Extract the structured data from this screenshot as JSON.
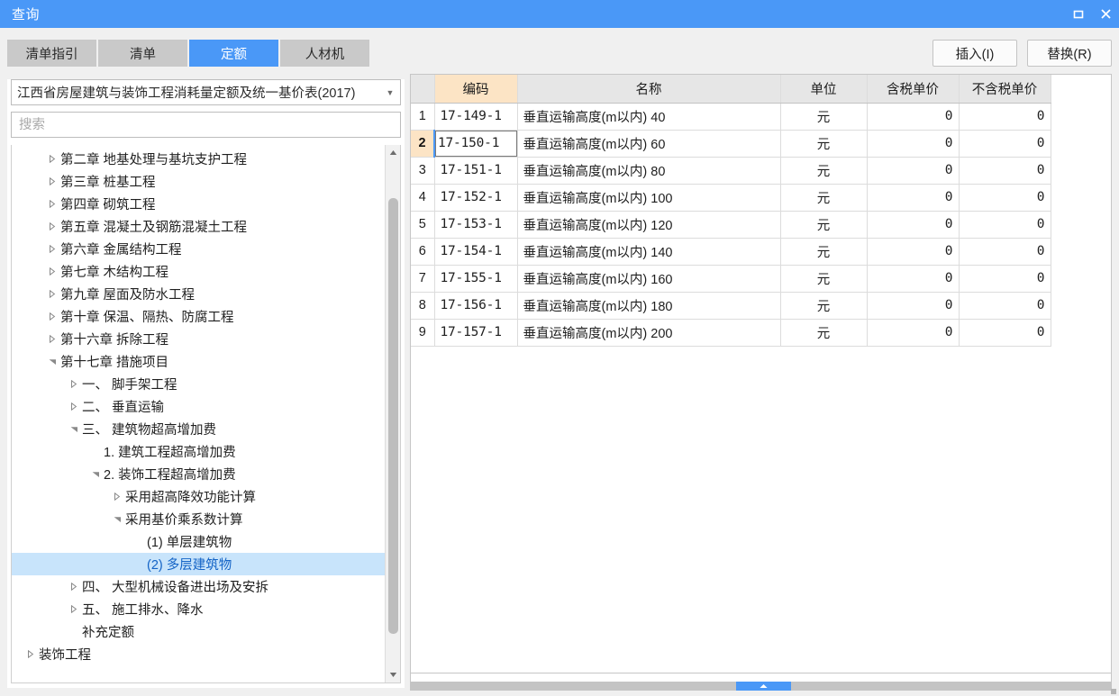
{
  "window": {
    "title": "查询",
    "controls": [
      {
        "name": "maximize",
        "icon": "maximize-icon"
      },
      {
        "name": "close",
        "icon": "close-icon"
      }
    ],
    "titlebar_color": "#4a98f7"
  },
  "tabs": [
    {
      "label": "清单指引",
      "active": false
    },
    {
      "label": "清单",
      "active": false
    },
    {
      "label": "定额",
      "active": true
    },
    {
      "label": "人材机",
      "active": false
    }
  ],
  "toolbar": {
    "insert_label": "插入(I)",
    "replace_label": "替换(R)"
  },
  "sidebar": {
    "library_select": {
      "value": "江西省房屋建筑与装饰工程消耗量定额及统一基价表(2017)",
      "arrow_icon": "chevron-down-icon"
    },
    "search": {
      "value": "",
      "placeholder": "搜索"
    },
    "tree": [
      {
        "label": "第二章 地基处理与基坑支护工程",
        "indent": 1,
        "state": "collapsed",
        "selected": false
      },
      {
        "label": "第三章 桩基工程",
        "indent": 1,
        "state": "collapsed",
        "selected": false
      },
      {
        "label": "第四章 砌筑工程",
        "indent": 1,
        "state": "collapsed",
        "selected": false
      },
      {
        "label": "第五章 混凝土及钢筋混凝土工程",
        "indent": 1,
        "state": "collapsed",
        "selected": false
      },
      {
        "label": "第六章 金属结构工程",
        "indent": 1,
        "state": "collapsed",
        "selected": false
      },
      {
        "label": "第七章 木结构工程",
        "indent": 1,
        "state": "collapsed",
        "selected": false
      },
      {
        "label": "第九章 屋面及防水工程",
        "indent": 1,
        "state": "collapsed",
        "selected": false
      },
      {
        "label": "第十章 保温、隔热、防腐工程",
        "indent": 1,
        "state": "collapsed",
        "selected": false
      },
      {
        "label": "第十六章 拆除工程",
        "indent": 1,
        "state": "collapsed",
        "selected": false
      },
      {
        "label": "第十七章 措施项目",
        "indent": 1,
        "state": "expanded",
        "selected": false
      },
      {
        "label": "一、 脚手架工程",
        "indent": 2,
        "state": "collapsed",
        "selected": false
      },
      {
        "label": "二、 垂直运输",
        "indent": 2,
        "state": "collapsed",
        "selected": false
      },
      {
        "label": "三、 建筑物超高增加费",
        "indent": 2,
        "state": "expanded",
        "selected": false
      },
      {
        "label": "1. 建筑工程超高增加费",
        "indent": 3,
        "state": "leaf",
        "selected": false
      },
      {
        "label": "2. 装饰工程超高增加费",
        "indent": 3,
        "state": "expanded",
        "selected": false
      },
      {
        "label": "采用超高降效功能计算",
        "indent": 4,
        "state": "collapsed",
        "selected": false
      },
      {
        "label": "采用基价乘系数计算",
        "indent": 4,
        "state": "expanded",
        "selected": false
      },
      {
        "label": "(1) 单层建筑物",
        "indent": 5,
        "state": "leaf",
        "selected": false
      },
      {
        "label": "(2) 多层建筑物",
        "indent": 5,
        "state": "leaf",
        "selected": true
      },
      {
        "label": "四、 大型机械设备进出场及安拆",
        "indent": 2,
        "state": "collapsed",
        "selected": false
      },
      {
        "label": "五、 施工排水、降水",
        "indent": 2,
        "state": "collapsed",
        "selected": false
      },
      {
        "label": "补充定额",
        "indent": 2,
        "state": "leaf",
        "selected": false
      },
      {
        "label": "装饰工程",
        "indent": 0,
        "state": "collapsed",
        "selected": false
      }
    ],
    "scrollbar": {
      "up_icon": "scroll-up-arrow-icon",
      "down_icon": "scroll-down-arrow-icon"
    },
    "highlight_color": "#c8e4fb"
  },
  "table": {
    "columns": [
      {
        "key": "rowno",
        "label": ""
      },
      {
        "key": "code",
        "label": "编码"
      },
      {
        "key": "name",
        "label": "名称"
      },
      {
        "key": "unit",
        "label": "单位"
      },
      {
        "key": "taxed_price",
        "label": "含税单价"
      },
      {
        "key": "untaxed_price",
        "label": "不含税单价"
      }
    ],
    "code_header_color": "#fce4c5",
    "rows": [
      {
        "rowno": "1",
        "code": "17-149-1",
        "name": "垂直运输高度(m以内) 40",
        "unit": "元",
        "taxed_price": "0",
        "untaxed_price": "0",
        "selected": false
      },
      {
        "rowno": "2",
        "code": "17-150-1",
        "name": "垂直运输高度(m以内) 60",
        "unit": "元",
        "taxed_price": "0",
        "untaxed_price": "0",
        "selected": true
      },
      {
        "rowno": "3",
        "code": "17-151-1",
        "name": "垂直运输高度(m以内) 80",
        "unit": "元",
        "taxed_price": "0",
        "untaxed_price": "0",
        "selected": false
      },
      {
        "rowno": "4",
        "code": "17-152-1",
        "name": "垂直运输高度(m以内) 100",
        "unit": "元",
        "taxed_price": "0",
        "untaxed_price": "0",
        "selected": false
      },
      {
        "rowno": "5",
        "code": "17-153-1",
        "name": "垂直运输高度(m以内) 120",
        "unit": "元",
        "taxed_price": "0",
        "untaxed_price": "0",
        "selected": false
      },
      {
        "rowno": "6",
        "code": "17-154-1",
        "name": "垂直运输高度(m以内) 140",
        "unit": "元",
        "taxed_price": "0",
        "untaxed_price": "0",
        "selected": false
      },
      {
        "rowno": "7",
        "code": "17-155-1",
        "name": "垂直运输高度(m以内) 160",
        "unit": "元",
        "taxed_price": "0",
        "untaxed_price": "0",
        "selected": false
      },
      {
        "rowno": "8",
        "code": "17-156-1",
        "name": "垂直运输高度(m以内) 180",
        "unit": "元",
        "taxed_price": "0",
        "untaxed_price": "0",
        "selected": false
      },
      {
        "rowno": "9",
        "code": "17-157-1",
        "name": "垂直运输高度(m以内) 200",
        "unit": "元",
        "taxed_price": "0",
        "untaxed_price": "0",
        "selected": false
      }
    ]
  },
  "splitter": {
    "handle_icon": "collapse-up-arrow-icon",
    "color": "#4a98f7"
  }
}
